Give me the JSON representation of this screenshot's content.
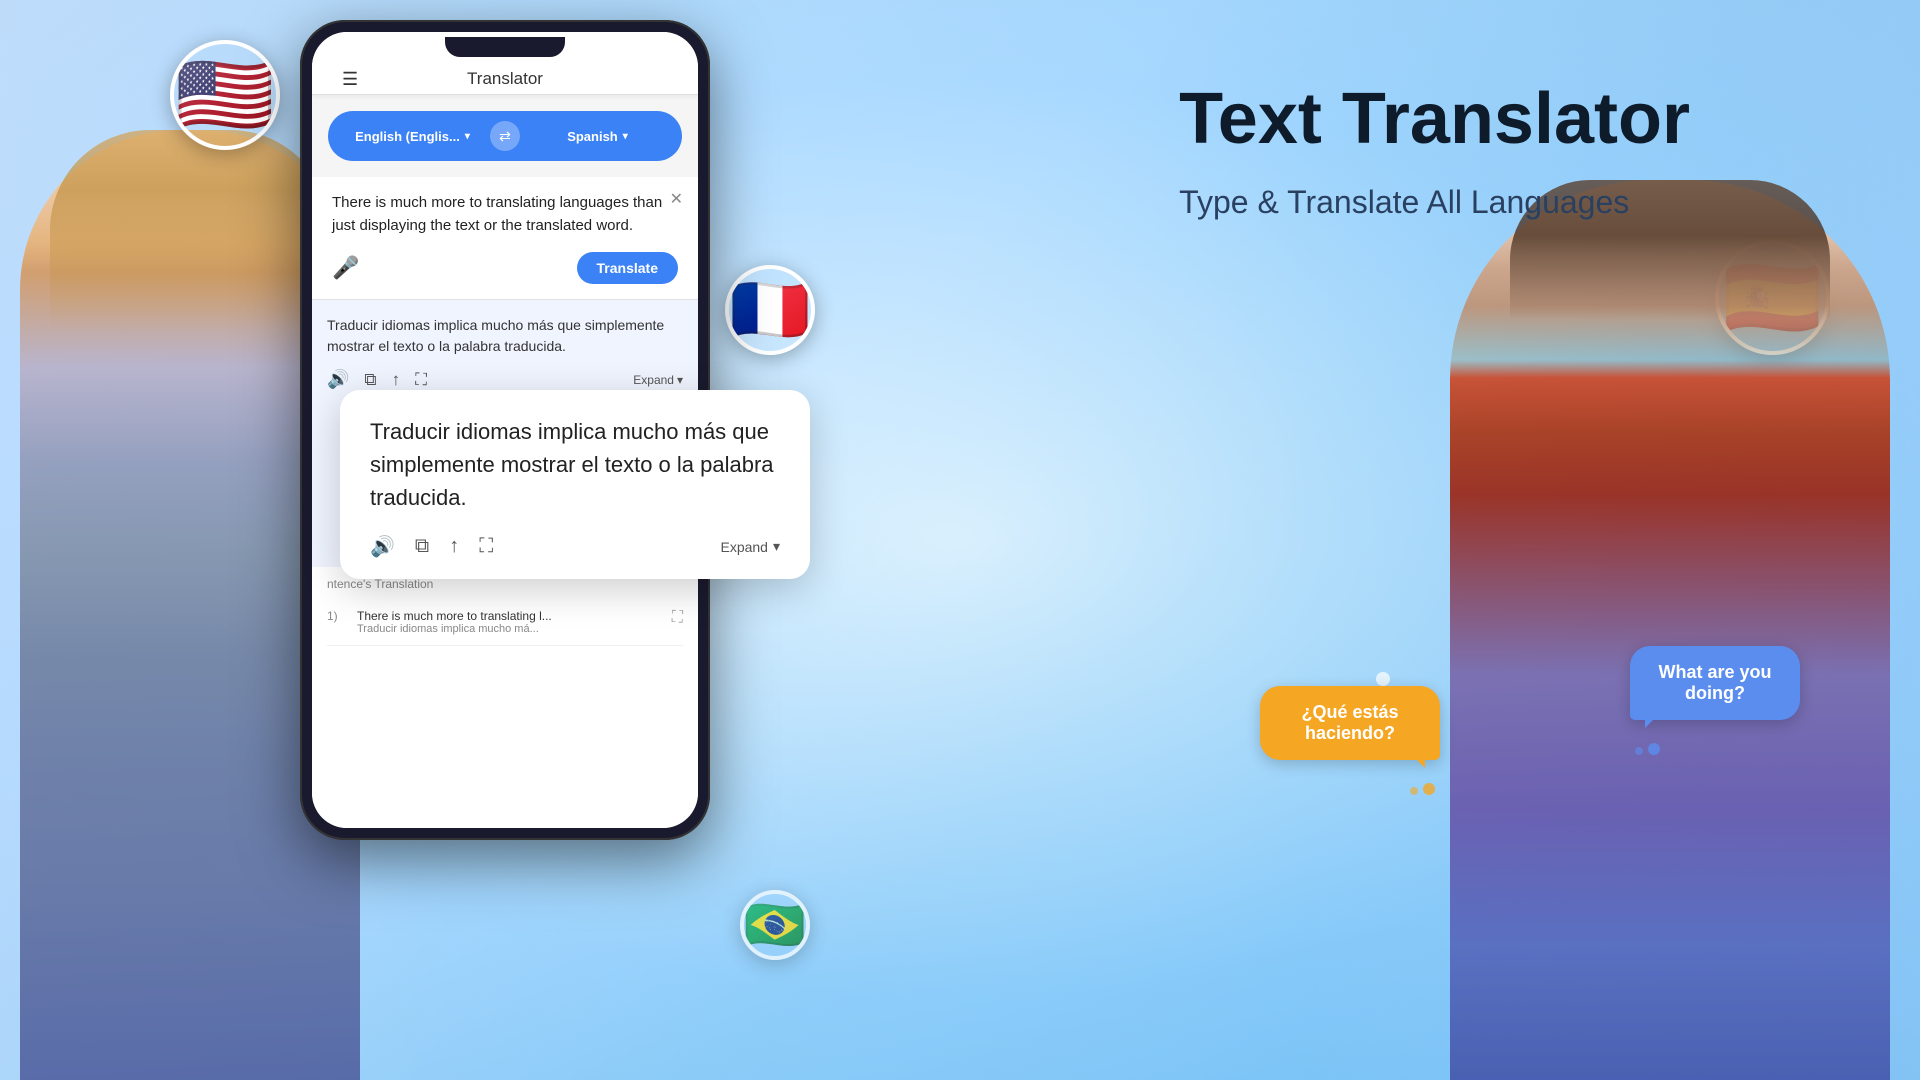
{
  "app": {
    "title": "Text Translator",
    "subtitle": "Type & Translate All Languages",
    "phone_header": "Translator"
  },
  "languages": {
    "source": "English (Englis...",
    "target": "Spanish",
    "source_full": "English",
    "target_full": "Spanish"
  },
  "input": {
    "text": "There is much more to translating languages than just displaying the text or the translated word.",
    "translate_button": "Translate"
  },
  "translation": {
    "text": "Traducir idiomas implica mucho más que simplemente mostrar el texto o la palabra traducida.",
    "expand_label": "Expand"
  },
  "history": {
    "title": "ntence's Translation",
    "items": [
      {
        "num": "1)",
        "original": "There is much more to translating l...",
        "translated": "Traducir idiomas implica mucho má..."
      }
    ]
  },
  "chat_bubbles": {
    "spanish": "¿Qué estás haciendo?",
    "english": "What are you doing?"
  },
  "flags": {
    "us": "🇺🇸",
    "france": "🇫🇷",
    "spain": "🇪🇸",
    "brazil": "🇧🇷"
  },
  "icons": {
    "hamburger": "☰",
    "swap": "⇄",
    "close": "✕",
    "mic": "🎤",
    "chevron_down": "▾",
    "volume": "🔊",
    "copy": "⧉",
    "share": "⇧",
    "expand_icon": "⛶",
    "expand_arrows": "⛶"
  }
}
